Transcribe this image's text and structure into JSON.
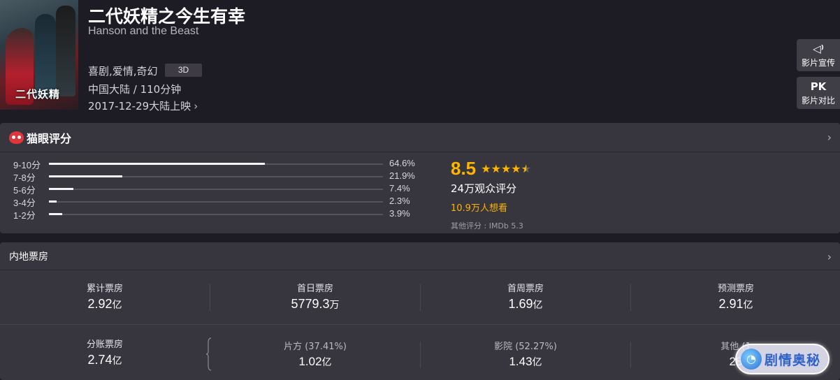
{
  "movie": {
    "poster_text": "二代妖精",
    "title": "二代妖精之今生有幸",
    "english_title": "Hanson and the Beast",
    "genres": "喜剧,爱情,奇幻",
    "format_badge": "3D",
    "region_duration": "中国大陆 / 110分钟",
    "release": "2017-12-29大陆上映",
    "release_chevron": "›"
  },
  "side_buttons": [
    {
      "icon": "◁⁾",
      "label": "影片宣传"
    },
    {
      "icon": "PK",
      "label": "影片对比"
    }
  ],
  "rating": {
    "header": "猫眼评分",
    "chevron": "›",
    "distribution": [
      {
        "label": "9-10分",
        "percent_text": "64.6%",
        "percent": 64.6
      },
      {
        "label": "7-8分",
        "percent_text": "21.9%",
        "percent": 21.9
      },
      {
        "label": "5-6分",
        "percent_text": "7.4%",
        "percent": 7.4
      },
      {
        "label": "3-4分",
        "percent_text": "2.3%",
        "percent": 2.3
      },
      {
        "label": "1-2分",
        "percent_text": "3.9%",
        "percent": 3.9
      }
    ],
    "score": "8.5",
    "stars": "★★★★",
    "half_star": "★",
    "voters": "24万观众评分",
    "want_to_see": "10.9万人想看",
    "other_rating": "其他评分 : IMDb 5.3"
  },
  "box_office": {
    "header": "内地票房",
    "chevron": "›",
    "row1": [
      {
        "label": "累计票房",
        "value": "2.92",
        "unit": "亿"
      },
      {
        "label": "首日票房",
        "value": "5779.3",
        "unit": "万"
      },
      {
        "label": "首周票房",
        "value": "1.69",
        "unit": "亿"
      },
      {
        "label": "预测票房",
        "value": "2.91",
        "unit": "亿"
      }
    ],
    "row2": [
      {
        "label": "分账票房",
        "value": "2.74",
        "unit": "亿"
      },
      {
        "label": "片方 (37.41%)",
        "value": "1.02",
        "unit": "亿"
      },
      {
        "label": "影院 (52.27%)",
        "value": "1.43",
        "unit": "亿"
      },
      {
        "label": "其他 (1",
        "value": "28",
        "unit": ""
      }
    ]
  },
  "watermark": {
    "logo": "◔",
    "text": "剧情奥秘"
  },
  "colors": {
    "accent": "#ffb400",
    "background": "#1d1b24",
    "card": "#37353d",
    "brand_red": "#e0353a"
  }
}
